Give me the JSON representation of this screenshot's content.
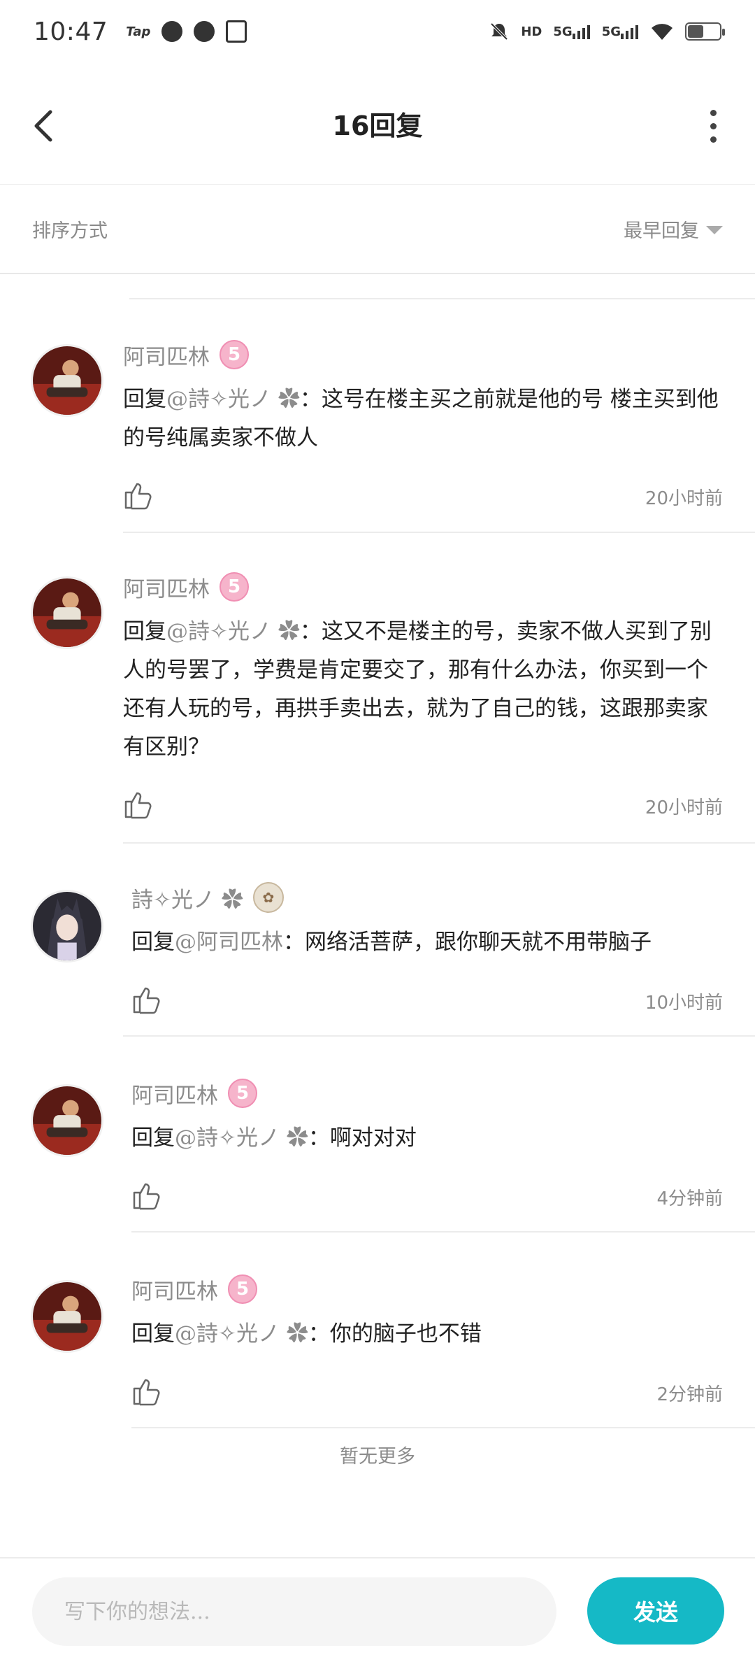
{
  "status_bar": {
    "time": "10:47",
    "left_icons": [
      {
        "icon": "taptap-icon",
        "text": "Tap"
      },
      {
        "icon": "cat-app-icon",
        "text": ""
      },
      {
        "icon": "speed-app-icon",
        "text": ""
      },
      {
        "icon": "clipboard-app-icon",
        "text": ""
      }
    ],
    "net_labels": [
      "HD",
      "5G",
      "5G"
    ]
  },
  "header": {
    "title": "16回复"
  },
  "sort": {
    "label": "排序方式",
    "value": "最早回复"
  },
  "replies": [
    {
      "user": "阿司匹林",
      "badge": "5",
      "reply_prefix": "回复",
      "mention": "@詩✧光ノ ✿",
      "content": "：这号在楼主买之前就是他的号 楼主买到他的号纯属卖家不做人",
      "time": "20小时前",
      "avatar": "red-room-avatar"
    },
    {
      "user": "阿司匹林",
      "badge": "5",
      "reply_prefix": "回复",
      "mention": "@詩✧光ノ ✿",
      "content": "：这又不是楼主的号，卖家不做人买到了别人的号罢了，学费是肯定要交了，那有什么办法，你买到一个还有人玩的号，再拱手卖出去，就为了自己的钱，这跟那卖家有区别？",
      "time": "20小时前",
      "avatar": "red-room-avatar"
    },
    {
      "user": "詩✧光ノ ✿",
      "badge": "",
      "reply_prefix": "回复",
      "mention": "@阿司匹林",
      "content": "：网络活菩萨，跟你聊天就不用带脑子",
      "time": "10小时前",
      "avatar": "anime-girl-avatar"
    },
    {
      "user": "阿司匹林",
      "badge": "5",
      "reply_prefix": "回复",
      "mention": "@詩✧光ノ ✿",
      "content": "：啊对对对",
      "time": "4分钟前",
      "avatar": "red-room-avatar"
    },
    {
      "user": "阿司匹林",
      "badge": "5",
      "reply_prefix": "回复",
      "mention": "@詩✧光ノ ✿",
      "content": "：你的脑子也不错",
      "time": "2分钟前",
      "avatar": "red-room-avatar"
    }
  ],
  "no_more": "暂无更多",
  "composer": {
    "placeholder": "写下你的想法...",
    "send_label": "发送"
  },
  "colors": {
    "accent": "#15b9c6",
    "muted_text": "#8c8c8c",
    "badge_pink": "#f6b4cb"
  }
}
